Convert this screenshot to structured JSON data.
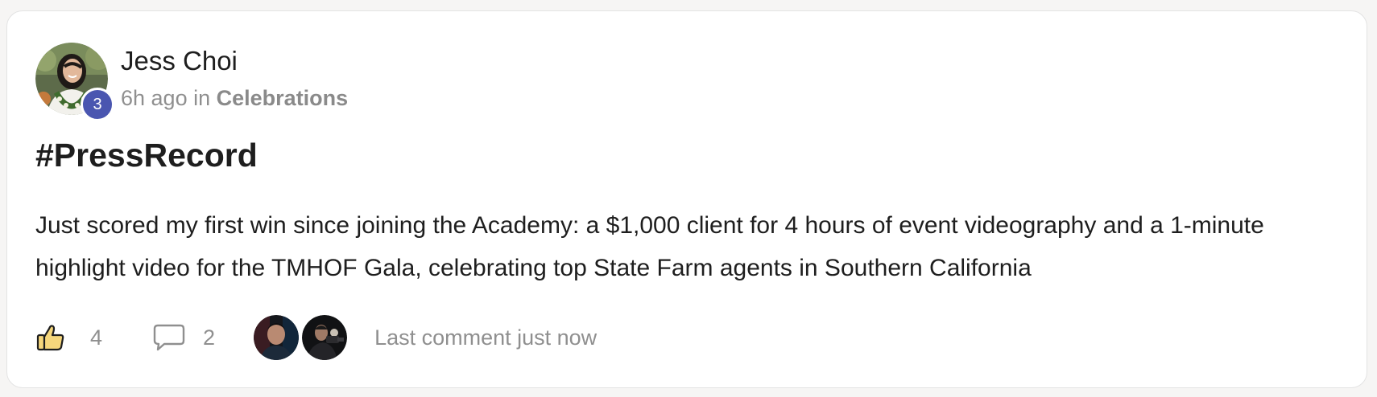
{
  "post": {
    "author": {
      "name": "Jess Choi",
      "level": "3"
    },
    "meta": {
      "time": "6h ago",
      "in_word": "in",
      "space": "Celebrations"
    },
    "title": "#PressRecord",
    "body": "Just scored my first win since joining the Academy: a $1,000 client for 4 hours of event videography and a 1-minute highlight video for the TMHOF Gala, celebrating top State Farm agents in Southern California",
    "footer": {
      "like_count": "4",
      "comment_count": "2",
      "last_comment": "Last comment just now"
    }
  },
  "icons": {
    "like": "thumbs-up-icon",
    "comment": "speech-bubble-icon"
  },
  "colors": {
    "level_badge": "#4a56b0",
    "like_fill": "#f6d77c",
    "muted_text": "#8f8f8f",
    "primary_text": "#1e1e1e"
  }
}
